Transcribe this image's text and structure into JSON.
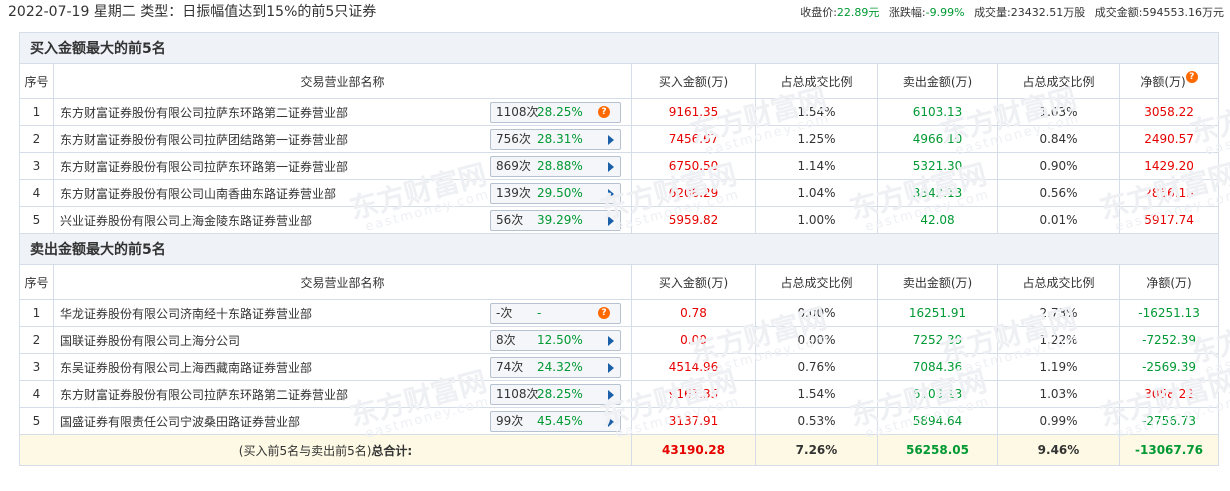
{
  "header": {
    "title": "2022-07-19 星期二 类型：日振幅值达到15%的前5只证券",
    "close_label": "收盘价:",
    "close_value": "22.89元",
    "change_label": "涨跌幅:",
    "change_value": "-9.99%",
    "volume_label": "成交量:",
    "volume_value": "23432.51万股",
    "amount_label": "成交金额:",
    "amount_value": "594553.16万元"
  },
  "watermark": {
    "cn": "东方财富网",
    "en": "eastmoney.com"
  },
  "columns": [
    "序号",
    "交易营业部名称",
    "买入金额(万)",
    "占总成交比例",
    "卖出金额(万)",
    "占总成交比例",
    "净额(万)"
  ],
  "buy": {
    "title": "买入金额最大的前5名",
    "rows": [
      {
        "idx": "1",
        "name": "东方财富证券股份有限公司拉萨东环路第二证券营业部",
        "times": "1108次",
        "rate": "28.25%",
        "icon": "question-icon",
        "buy": "9161.35",
        "buy_pct": "1.54%",
        "sell": "6103.13",
        "sell_pct": "1.03%",
        "net": "3058.22"
      },
      {
        "idx": "2",
        "name": "东方财富证券股份有限公司拉萨团结路第一证券营业部",
        "times": "756次",
        "rate": "28.31%",
        "icon": "arrow-right-icon",
        "buy": "7456.67",
        "buy_pct": "1.25%",
        "sell": "4966.10",
        "sell_pct": "0.84%",
        "net": "2490.57"
      },
      {
        "idx": "3",
        "name": "东方财富证券股份有限公司拉萨东环路第一证券营业部",
        "times": "869次",
        "rate": "28.88%",
        "icon": "arrow-right-icon",
        "buy": "6750.50",
        "buy_pct": "1.14%",
        "sell": "5321.30",
        "sell_pct": "0.90%",
        "net": "1429.20"
      },
      {
        "idx": "4",
        "name": "东方财富证券股份有限公司山南香曲东路证券营业部",
        "times": "139次",
        "rate": "29.50%",
        "icon": "arrow-right-icon",
        "buy": "6208.29",
        "buy_pct": "1.04%",
        "sell": "3342.13",
        "sell_pct": "0.56%",
        "net": "2866.15"
      },
      {
        "idx": "5",
        "name": "兴业证券股份有限公司上海金陵东路证券营业部",
        "times": "56次",
        "rate": "39.29%",
        "icon": "arrow-right-icon",
        "buy": "5959.82",
        "buy_pct": "1.00%",
        "sell": "42.08",
        "sell_pct": "0.01%",
        "net": "5917.74"
      }
    ]
  },
  "sell": {
    "title": "卖出金额最大的前5名",
    "rows": [
      {
        "idx": "1",
        "name": "华龙证券股份有限公司济南经十东路证券营业部",
        "times": "-次",
        "rate": "-",
        "icon": "question-icon",
        "buy": "0.78",
        "buy_pct": "0.00%",
        "sell": "16251.91",
        "sell_pct": "2.73%",
        "net": "-16251.13"
      },
      {
        "idx": "2",
        "name": "国联证券股份有限公司上海分公司",
        "times": "8次",
        "rate": "12.50%",
        "icon": "arrow-right-icon",
        "buy": "0.00",
        "buy_pct": "0.00%",
        "sell": "7252.39",
        "sell_pct": "1.22%",
        "net": "-7252.39"
      },
      {
        "idx": "3",
        "name": "东吴证券股份有限公司上海西藏南路证券营业部",
        "times": "74次",
        "rate": "24.32%",
        "icon": "arrow-right-icon",
        "buy": "4514.96",
        "buy_pct": "0.76%",
        "sell": "7084.36",
        "sell_pct": "1.19%",
        "net": "-2569.39"
      },
      {
        "idx": "4",
        "name": "东方财富证券股份有限公司拉萨东环路第二证券营业部",
        "times": "1108次",
        "rate": "28.25%",
        "icon": "arrow-right-icon",
        "buy": "9161.35",
        "buy_pct": "1.54%",
        "sell": "6103.13",
        "sell_pct": "1.03%",
        "net": "3058.22"
      },
      {
        "idx": "5",
        "name": "国盛证券有限责任公司宁波桑田路证券营业部",
        "times": "99次",
        "rate": "45.45%",
        "icon": "arrow-right-icon",
        "buy": "3137.91",
        "buy_pct": "0.53%",
        "sell": "5894.64",
        "sell_pct": "0.99%",
        "net": "-2756.73"
      }
    ]
  },
  "total": {
    "label_prefix": "(买入前5名与卖出前5名)",
    "label_bold": "总合计:",
    "buy": "43190.28",
    "buy_pct": "7.26%",
    "sell": "56258.05",
    "sell_pct": "9.46%",
    "net": "-13067.76"
  },
  "colors": {
    "up": "#e60000",
    "down": "#009933",
    "accent": "#1a5fa8"
  }
}
